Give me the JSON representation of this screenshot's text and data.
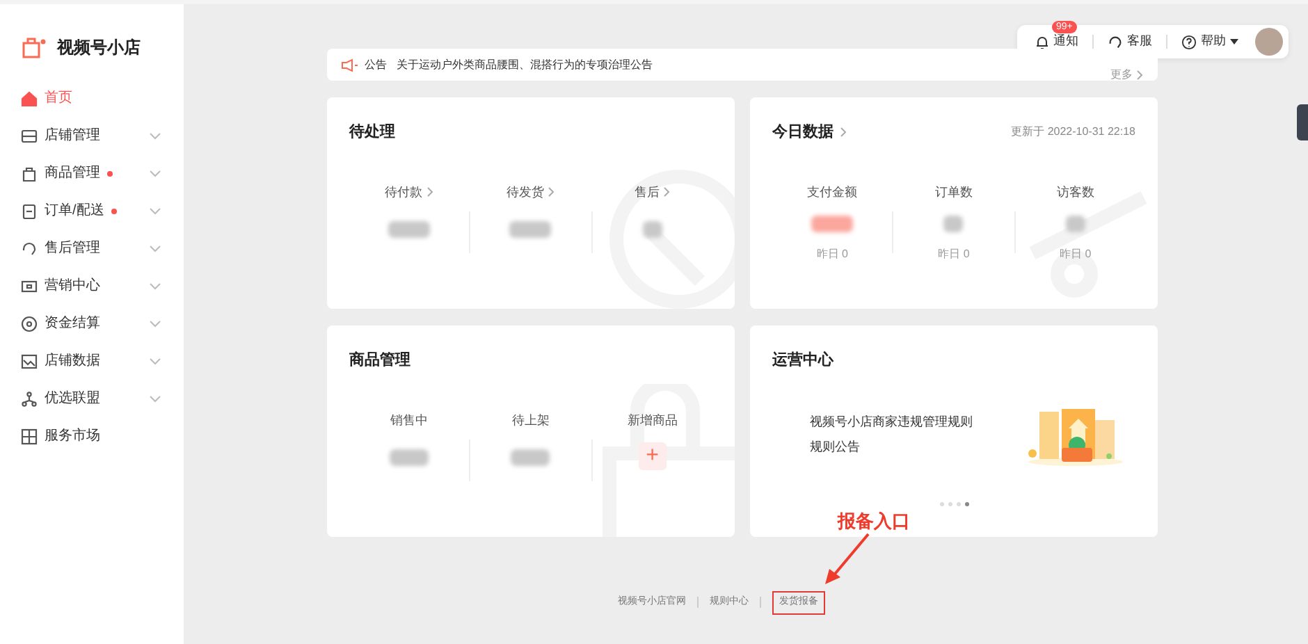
{
  "brand": {
    "name": "视频号小店"
  },
  "sidebar": {
    "items": [
      {
        "label": "首页",
        "kind": "home",
        "selected": true,
        "dot": false,
        "expandable": false
      },
      {
        "label": "店铺管理",
        "kind": "store",
        "selected": false,
        "dot": false,
        "expandable": true
      },
      {
        "label": "商品管理",
        "kind": "bag",
        "selected": false,
        "dot": true,
        "expandable": true
      },
      {
        "label": "订单/配送",
        "kind": "order",
        "selected": false,
        "dot": true,
        "expandable": true
      },
      {
        "label": "售后管理",
        "kind": "headset",
        "selected": false,
        "dot": false,
        "expandable": true
      },
      {
        "label": "营销中心",
        "kind": "ticket",
        "selected": false,
        "dot": false,
        "expandable": true
      },
      {
        "label": "资金结算",
        "kind": "coin",
        "selected": false,
        "dot": false,
        "expandable": true
      },
      {
        "label": "店铺数据",
        "kind": "chart",
        "selected": false,
        "dot": false,
        "expandable": true
      },
      {
        "label": "优选联盟",
        "kind": "network",
        "selected": false,
        "dot": false,
        "expandable": true
      },
      {
        "label": "服务市场",
        "kind": "grid",
        "selected": false,
        "dot": false,
        "expandable": false
      }
    ]
  },
  "header": {
    "notifications": {
      "label": "通知",
      "badge": "99+"
    },
    "service": {
      "label": "客服"
    },
    "help": {
      "label": "帮助"
    }
  },
  "notice": {
    "tag": "公告",
    "text": "关于运动户外类商品腰围、混搭行为的专项治理公告",
    "more": "更多"
  },
  "pending": {
    "title": "待处理",
    "stats": [
      {
        "label": "待付款"
      },
      {
        "label": "待发货"
      },
      {
        "label": "售后"
      }
    ]
  },
  "today": {
    "title": "今日数据",
    "updated": "更新于 2022-10-31 22:18",
    "stats": [
      {
        "label": "支付金额",
        "accent": true,
        "yesterday": "昨日 0"
      },
      {
        "label": "订单数",
        "accent": false,
        "yesterday": "昨日 0"
      },
      {
        "label": "访客数",
        "accent": false,
        "yesterday": "昨日 0"
      }
    ]
  },
  "products": {
    "title": "商品管理",
    "stats": [
      {
        "label": "销售中"
      },
      {
        "label": "待上架"
      }
    ],
    "add": {
      "label": "新增商品",
      "symbol": "+"
    }
  },
  "operations": {
    "title": "运营中心",
    "lines": [
      "视频号小店商家违规管理规则",
      "规则公告"
    ],
    "dots": [
      {
        "selected": false
      },
      {
        "selected": false
      },
      {
        "selected": false
      },
      {
        "selected": true
      }
    ]
  },
  "footer": {
    "links": [
      "视频号小店官网",
      "规则中心",
      "发货报备"
    ]
  },
  "annotation": {
    "text": "报备入口"
  }
}
